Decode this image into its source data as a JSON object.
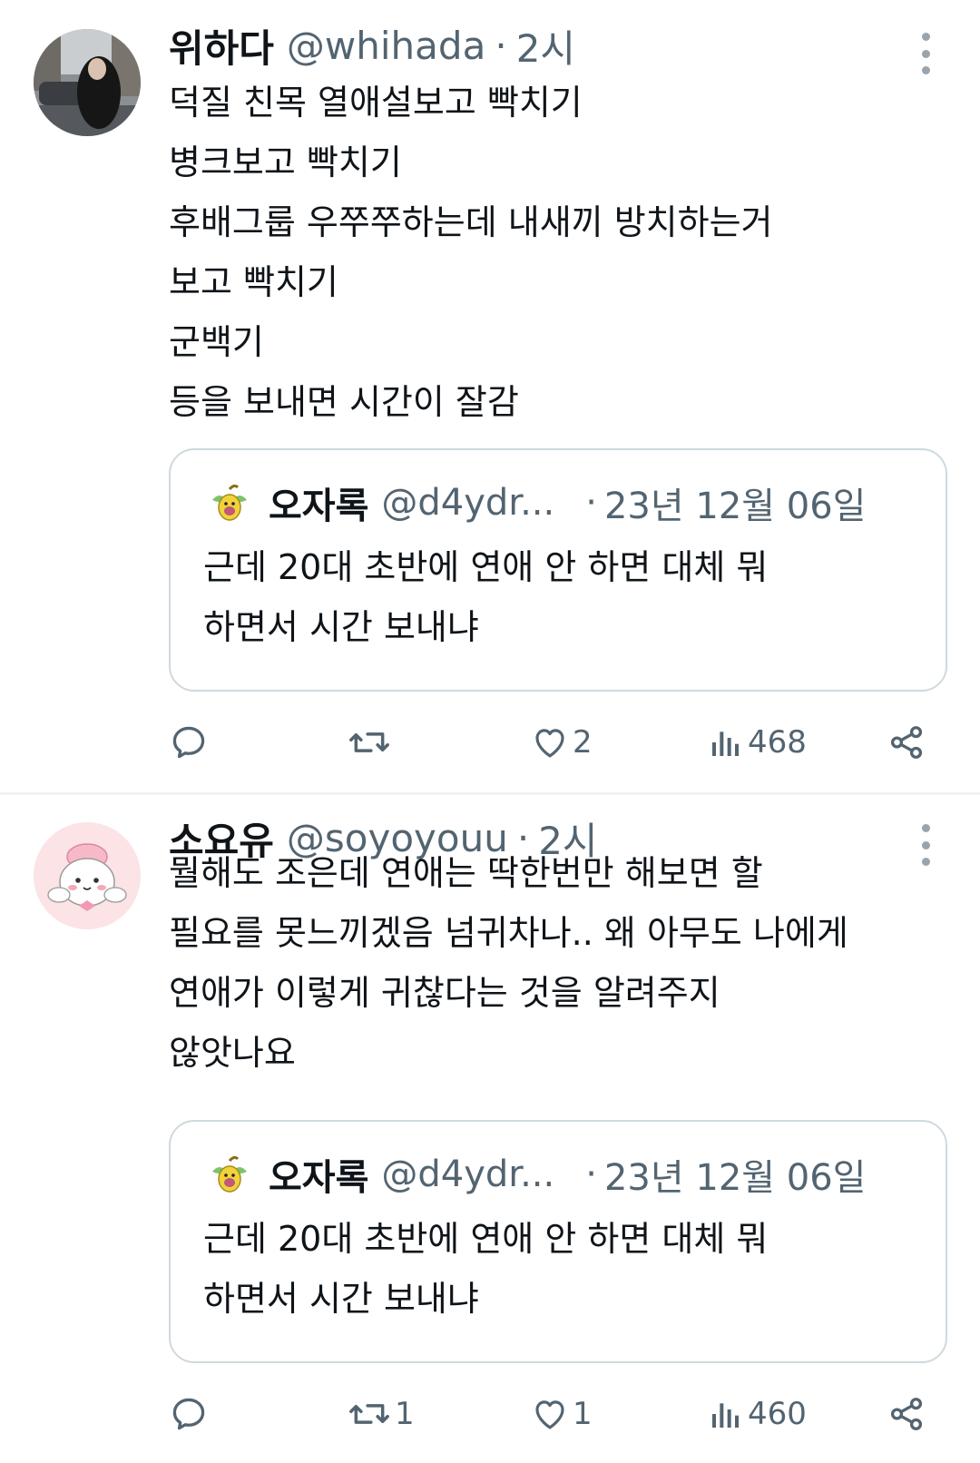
{
  "tweets": [
    {
      "author": {
        "display_name": "위하다",
        "handle": "@whihada",
        "separator": "·",
        "time": "2시"
      },
      "avatar_icon": "profile-photo-woman",
      "text_lines": [
        "덕질 친목 열애설보고 빡치기",
        "병크보고 빡치기",
        "후배그룹 우쭈쭈하는데 내새끼 방치하는거",
        "보고 빡치기",
        "군백기",
        "등을 보내면 시간이 잘감"
      ],
      "quote": {
        "display_name": "오자록",
        "handle": "@d4ydr...",
        "separator": "·",
        "date": "23년 12월 06일",
        "avatar_icon": "weepinbell-icon",
        "text_lines": [
          "근데 20대 초반에 연애 안 하면 대체 뭐",
          "하면서 시간 보내냐"
        ]
      },
      "actions": {
        "reply": "",
        "retweet": "",
        "like": "2",
        "views": "468"
      }
    },
    {
      "author": {
        "display_name": "소요유",
        "handle": "@soyoyouu",
        "separator": "·",
        "time": "2시"
      },
      "avatar_icon": "cute-character-avatar",
      "text_lines": [
        "뭘해도 조은데 연애는 딱한번만 해보면 할",
        "필요를 못느끼겠음 넘귀차나.. 왜 아무도 나에게",
        "연애가 이렇게 귀찮다는 것을 알려주지",
        "않앗나요"
      ],
      "quote": {
        "display_name": "오자록",
        "handle": "@d4ydr...",
        "separator": "·",
        "date": "23년 12월 06일",
        "avatar_icon": "weepinbell-icon",
        "text_lines": [
          "근데 20대 초반에 연애 안 하면 대체 뭐",
          "하면서 시간 보내냐"
        ]
      },
      "actions": {
        "reply": "",
        "retweet": "1",
        "like": "1",
        "views": "460"
      }
    }
  ],
  "colors": {
    "text": "#0f1419",
    "secondary": "#536471",
    "border": "#cfd9de"
  }
}
